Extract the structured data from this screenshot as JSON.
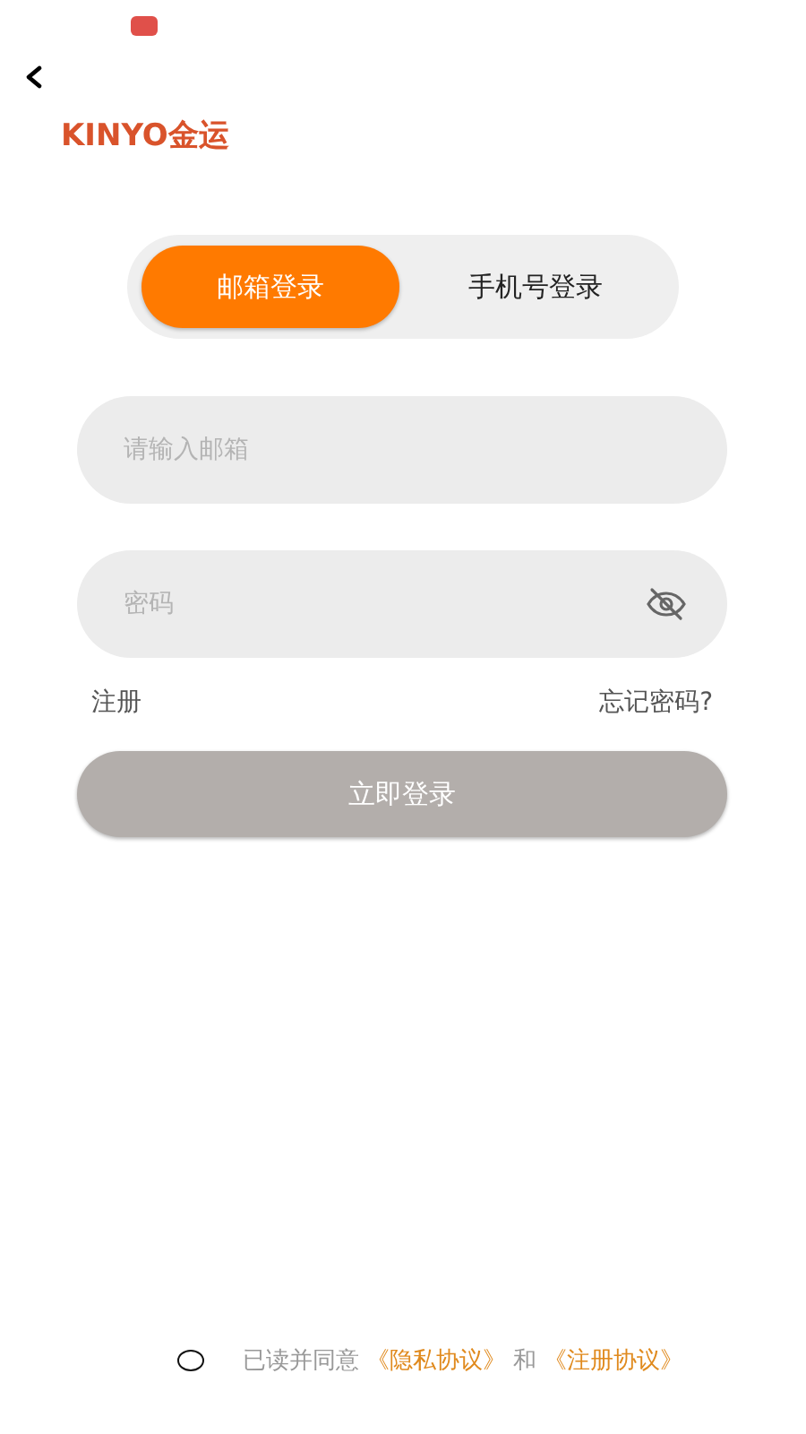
{
  "logo": {
    "text": "KINYO金运"
  },
  "tabs": [
    {
      "label": "邮箱登录",
      "selected": true
    },
    {
      "label": "手机号登录",
      "selected": false
    }
  ],
  "fields": [
    {
      "kind": "text",
      "placeholder": "请输入邮箱"
    },
    {
      "kind": "password",
      "placeholder": "密码"
    }
  ],
  "links": {
    "register": "注册",
    "forgot": "忘记密码?"
  },
  "login_button": {
    "label": "立即登录"
  },
  "agreement": {
    "checked": false,
    "parts": [
      {
        "kind": "text",
        "text": "已读并同意"
      },
      {
        "kind": "link",
        "text": "《隐私协议》"
      },
      {
        "kind": "text",
        "text": "和"
      },
      {
        "kind": "link",
        "text": "《注册协议》"
      }
    ]
  }
}
